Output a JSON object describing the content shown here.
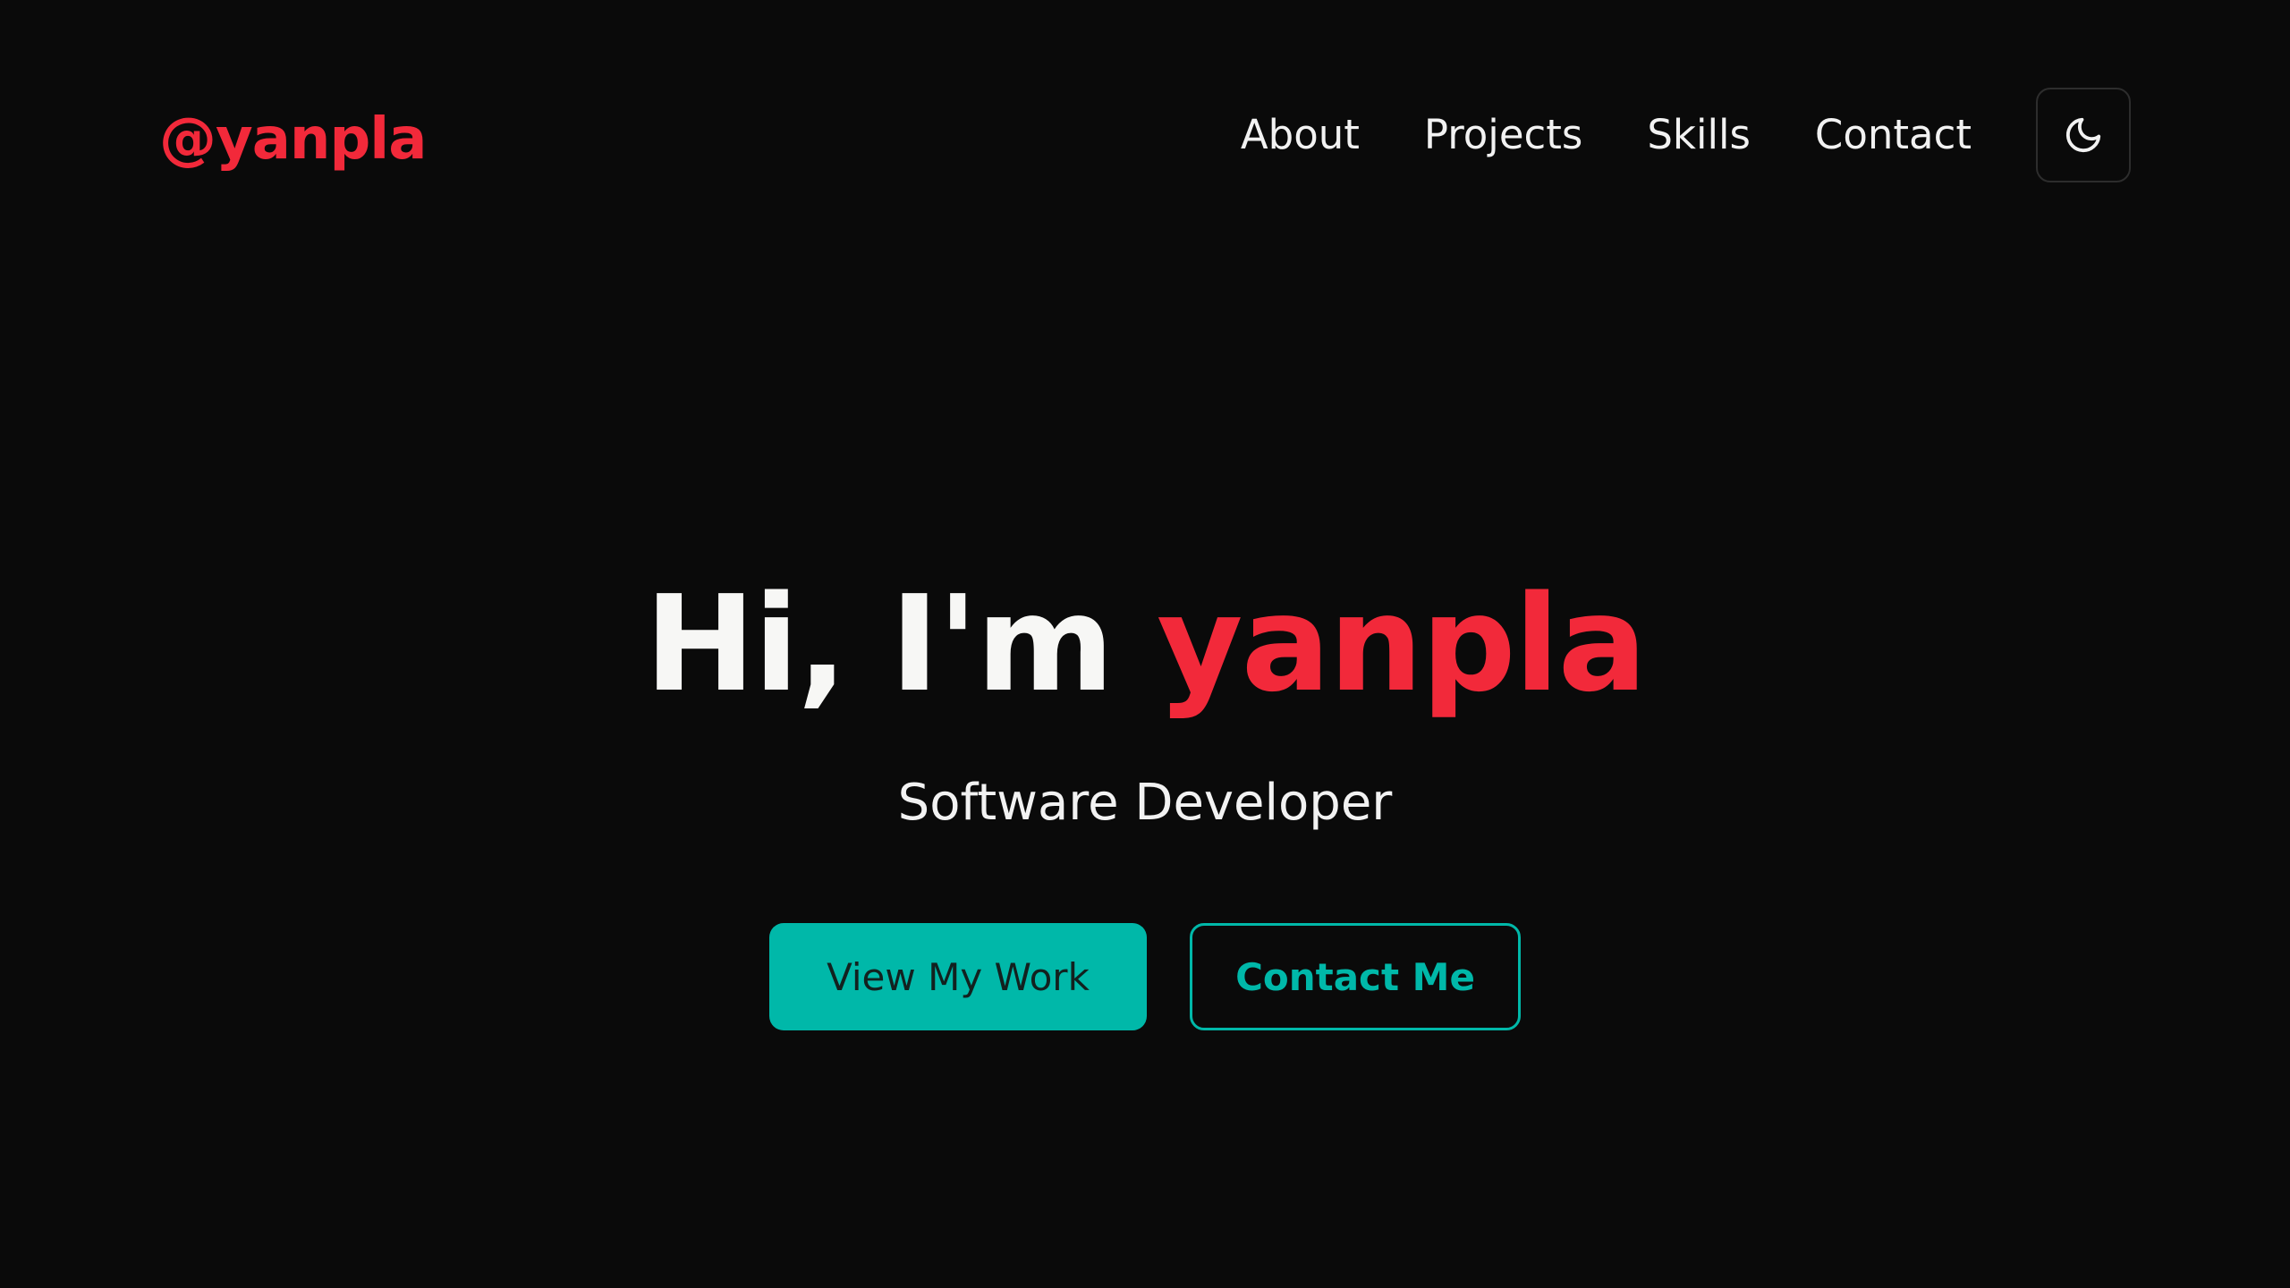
{
  "header": {
    "logo": "@yanpla",
    "nav": {
      "about": "About",
      "projects": "Projects",
      "skills": "Skills",
      "contact": "Contact"
    },
    "theme_toggle_icon": "moon-icon"
  },
  "hero": {
    "greeting": "Hi, I'm",
    "name": "yanpla",
    "subtitle": "Software Developer",
    "primary_cta": "View My Work",
    "secondary_cta": "Contact Me"
  },
  "colors": {
    "background": "#0a0a0a",
    "accent_red": "#f2293a",
    "accent_teal": "#00b8a9",
    "text": "#f2f2f2"
  }
}
